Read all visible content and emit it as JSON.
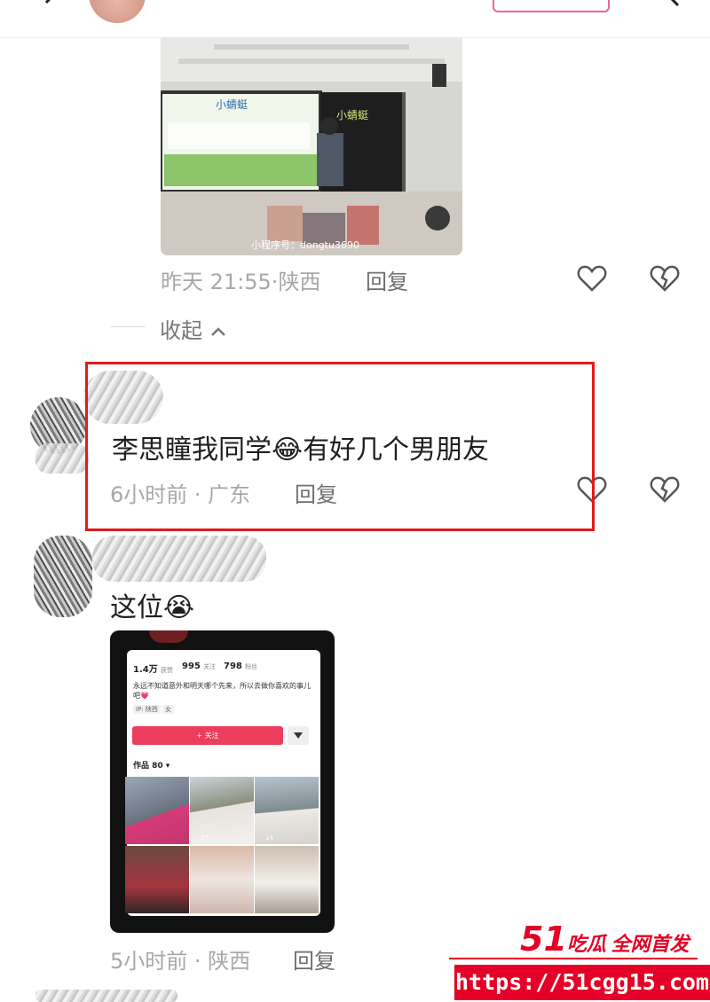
{
  "comments": [
    {
      "time": "昨天 21:55",
      "location": "陕西",
      "reply_label": "回复",
      "photo_caption": "小蜻蜓",
      "photo_watermark": "小程序号：dongtu3690"
    },
    {
      "text": "李思瞳我同学",
      "emoji": "😂",
      "text_after_emoji": "有好几个男朋友",
      "time": "6小时前",
      "location": "广东",
      "reply_label": "回复"
    },
    {
      "text": "这位",
      "emoji": "😭",
      "time": "5小时前",
      "location": "陕西",
      "reply_label": "回复"
    }
  ],
  "collapse_label": "收起",
  "profile_card": {
    "likes_value": "1.4万",
    "likes_label": "获赞",
    "following_value": "995",
    "following_label": "关注",
    "followers_value": "798",
    "followers_label": "粉丝",
    "bio": "永远不知道意外和明天哪个先来，所以去做你喜欢的事儿吧💗",
    "tag_ip": "IP: 陕西",
    "tag_gender": "女",
    "follow_button": "+ 关注",
    "works_label": "作品 80 ▾",
    "thumb_likes": [
      "",
      "27",
      "14"
    ]
  },
  "watermark": {
    "brand_number": "51",
    "brand_name": "吃瓜",
    "brand_slogan": "全网首发",
    "url": "https://51cgg15.com"
  },
  "colors": {
    "highlight_border": "#e21b1b",
    "watermark_red": "#e40026",
    "follow_pink": "#ec3d5d"
  }
}
